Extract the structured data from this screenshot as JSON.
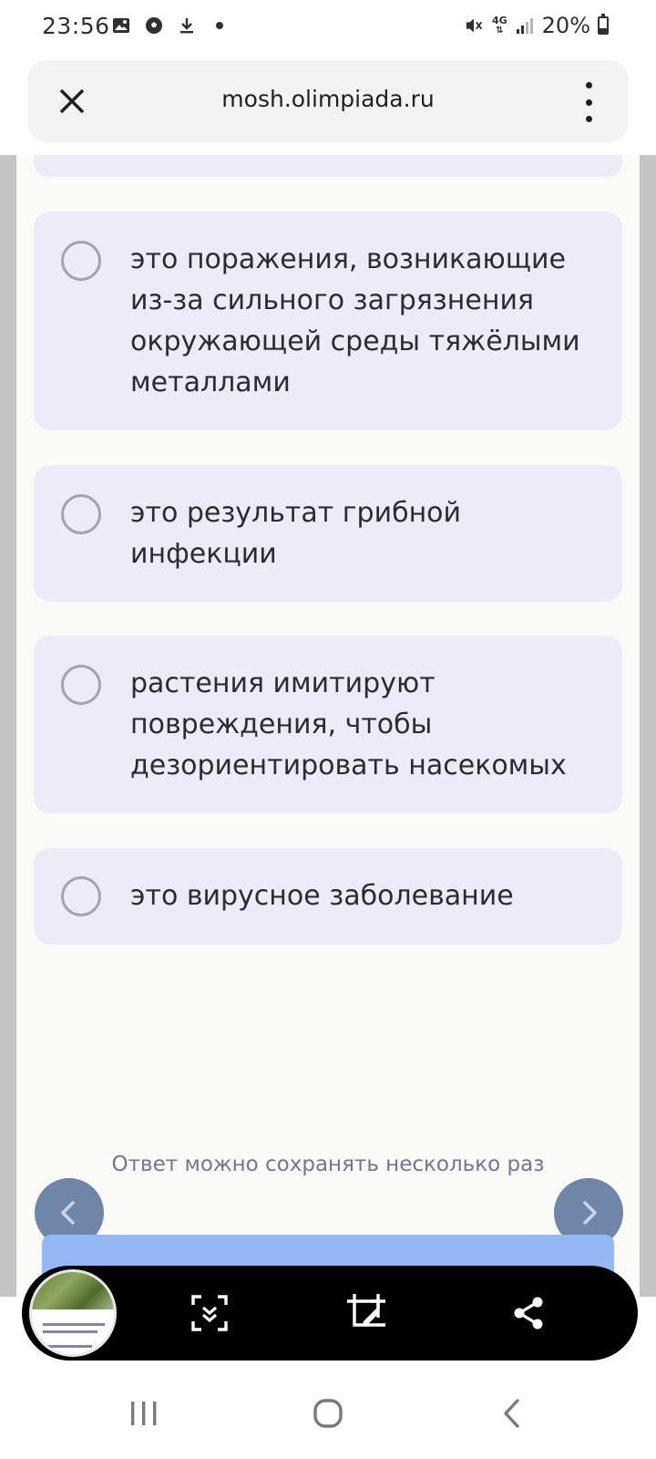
{
  "status_bar": {
    "time": "23:56",
    "battery_text": "20%",
    "network_label": "4G",
    "left_icons": [
      "image-icon",
      "soccer-ball-icon",
      "download-icon",
      "dot-icon"
    ],
    "right_icons": [
      "mute-icon",
      "network-4g-icon",
      "signal-icon",
      "battery-icon"
    ]
  },
  "browser": {
    "url": "mosh.olimpiada.ru",
    "close_icon": "close-icon",
    "menu_icon": "more-vert-icon"
  },
  "options": [
    {
      "text": "это поражения, возникающие из-за сильного загрязнения окружающей среды тяжёлыми металлами",
      "selected": false
    },
    {
      "text": "это результат грибной инфекции",
      "selected": false
    },
    {
      "text": "растения имитируют повреждения, чтобы дезориентировать насекомых",
      "selected": false
    },
    {
      "text": "это вирусное заболевание",
      "selected": false
    }
  ],
  "footer": {
    "note": "Ответ можно сохранять несколько раз",
    "prev_icon": "chevron-left-icon",
    "next_icon": "chevron-right-icon"
  },
  "screenshot_toolbar": {
    "icons": [
      "scroll-capture-icon",
      "crop-edit-icon",
      "share-icon"
    ]
  },
  "nav_bar": {
    "icons": [
      "recent-apps-icon",
      "home-icon",
      "back-icon"
    ]
  },
  "colors": {
    "option_bg": "#eeebf8",
    "page_bg": "#fafaf6",
    "nav_round": "#6f86a8",
    "submit": "#93b8f5",
    "note_text": "#6e7891"
  }
}
